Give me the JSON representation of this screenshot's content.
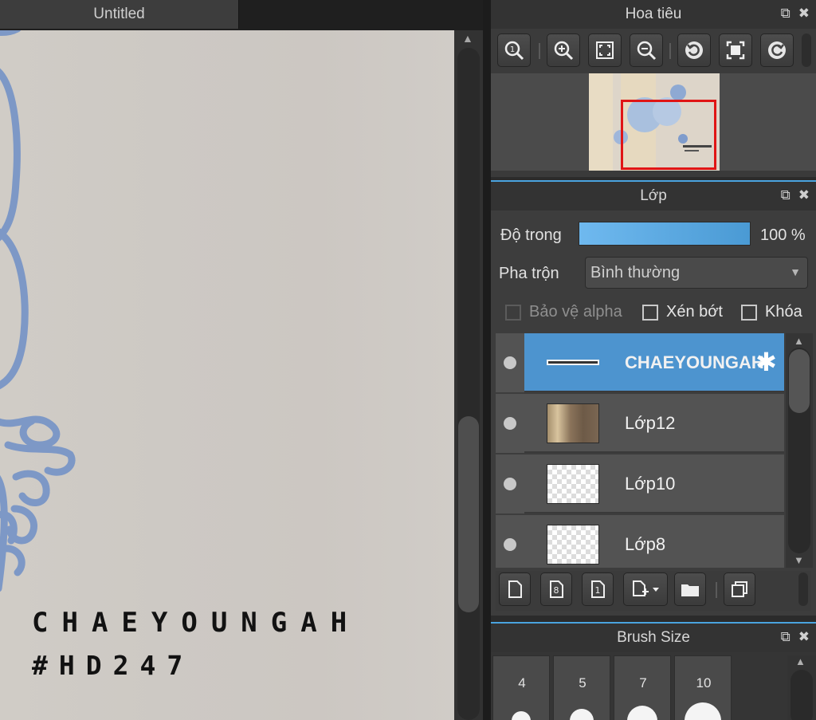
{
  "document": {
    "tab_title": "Untitled",
    "artwork_line_1": "CHAEYOUNGAH",
    "artwork_line_2": "#HD247"
  },
  "navigator": {
    "title": "Hoa tiêu",
    "tools": [
      "actual-size",
      "zoom-in",
      "fit-to-window",
      "zoom-out",
      "rotate-left",
      "fullscreen",
      "rotate-right"
    ]
  },
  "layers": {
    "title": "Lớp",
    "opacity_label": "Độ trong",
    "opacity_value": "100 %",
    "opacity_fraction": 1.0,
    "blend_label": "Pha trộn",
    "blend_value": "Bình thường",
    "protect_alpha_label": "Bảo vệ alpha",
    "clipping_label": "Xén bớt",
    "lock_label": "Khóa",
    "items": [
      {
        "name": "CHAEYOUNGAH",
        "selected": true
      },
      {
        "name": "Lớp12",
        "selected": false
      },
      {
        "name": "Lớp10",
        "selected": false
      },
      {
        "name": "Lớp8",
        "selected": false
      }
    ]
  },
  "brush_size": {
    "title": "Brush Size",
    "sizes": [
      "4",
      "5",
      "7",
      "10"
    ]
  },
  "colors": {
    "accent": "#4aa3df",
    "selected_layer": "#4d94cf",
    "nav_viewport": "#e01515",
    "doodle": "#7d98c6"
  }
}
